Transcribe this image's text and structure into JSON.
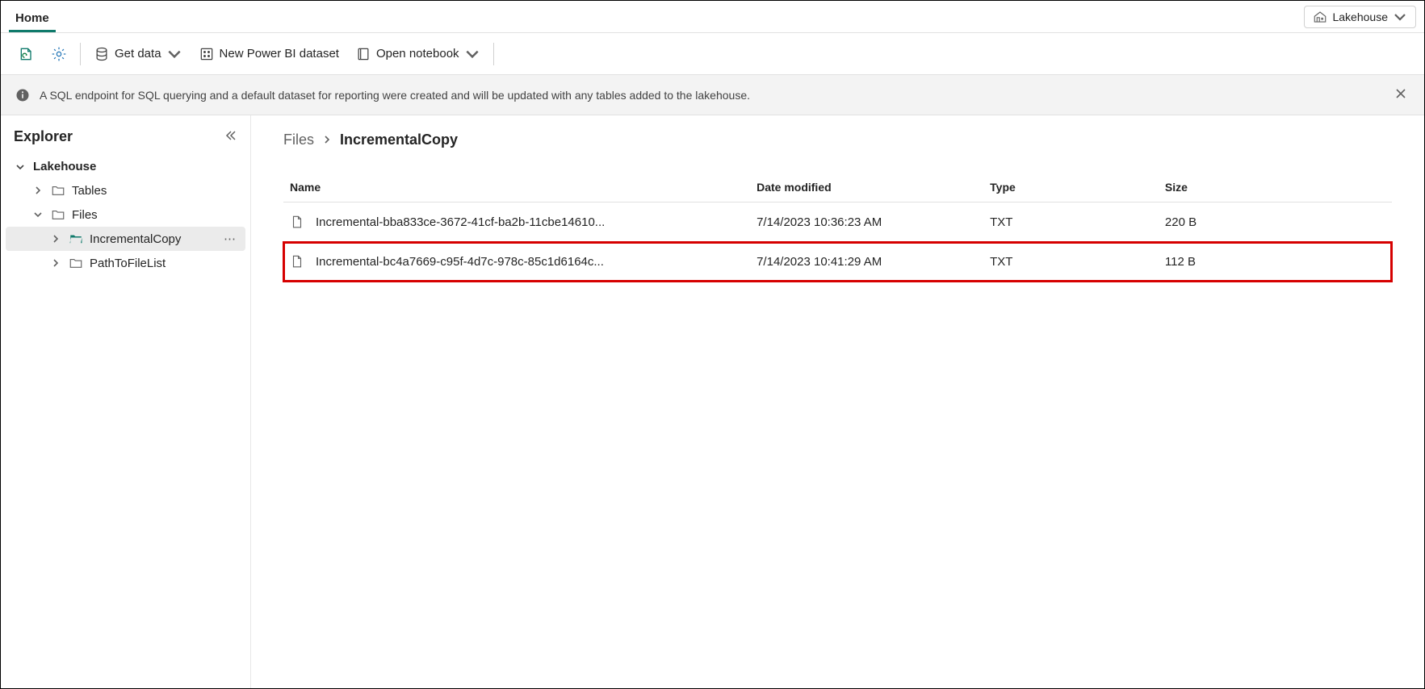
{
  "tabs": {
    "home": "Home"
  },
  "mode_selector": {
    "label": "Lakehouse"
  },
  "toolbar": {
    "get_data": "Get data",
    "new_dataset": "New Power BI dataset",
    "open_notebook": "Open notebook"
  },
  "notice": {
    "text": "A SQL endpoint for SQL querying and a default dataset for reporting were created and will be updated with any tables added to the lakehouse."
  },
  "explorer": {
    "title": "Explorer",
    "root": "Lakehouse",
    "items": {
      "tables": "Tables",
      "files": "Files",
      "incremental_copy": "IncrementalCopy",
      "path_to_file_list": "PathToFileList"
    }
  },
  "breadcrumb": {
    "parent": "Files",
    "current": "IncrementalCopy"
  },
  "columns": {
    "name": "Name",
    "date": "Date modified",
    "type": "Type",
    "size": "Size"
  },
  "files": [
    {
      "name": "Incremental-bba833ce-3672-41cf-ba2b-11cbe14610...",
      "date": "7/14/2023 10:36:23 AM",
      "type": "TXT",
      "size": "220 B",
      "highlighted": false
    },
    {
      "name": "Incremental-bc4a7669-c95f-4d7c-978c-85c1d6164c...",
      "date": "7/14/2023 10:41:29 AM",
      "type": "TXT",
      "size": "112 B",
      "highlighted": true
    }
  ]
}
